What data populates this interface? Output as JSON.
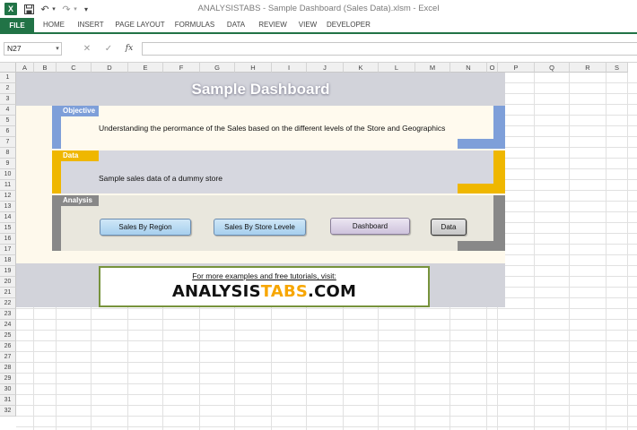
{
  "window": {
    "title": "ANALYSISTABS - Sample Dashboard (Sales Data).xlsm - Excel",
    "app_icon_letter": "X"
  },
  "quick_access": {
    "save_icon": "save-icon",
    "undo_icon": "undo-icon",
    "redo_icon": "redo-icon"
  },
  "ribbon": {
    "tabs": [
      {
        "label": "FILE",
        "active": true
      },
      {
        "label": "HOME"
      },
      {
        "label": "INSERT"
      },
      {
        "label": "PAGE LAYOUT"
      },
      {
        "label": "FORMULAS"
      },
      {
        "label": "DATA"
      },
      {
        "label": "REVIEW"
      },
      {
        "label": "VIEW"
      },
      {
        "label": "DEVELOPER"
      }
    ],
    "accent_color": "#217346"
  },
  "formula_bar": {
    "name_box": "N27",
    "cancel_glyph": "✕",
    "enter_glyph": "✓",
    "fx_label": "fx",
    "formula": ""
  },
  "sheet": {
    "columns": [
      "A",
      "B",
      "C",
      "D",
      "E",
      "F",
      "G",
      "H",
      "I",
      "J",
      "K",
      "L",
      "M",
      "N",
      "O",
      "P",
      "Q",
      "R",
      "S"
    ],
    "rows": [
      "1",
      "2",
      "3",
      "4",
      "5",
      "6",
      "7",
      "8",
      "9",
      "10",
      "11",
      "12",
      "13",
      "14",
      "15",
      "16",
      "17",
      "18",
      "19",
      "20",
      "21",
      "22",
      "23",
      "24",
      "25",
      "26",
      "27",
      "28",
      "29",
      "30",
      "31",
      "32"
    ]
  },
  "dashboard": {
    "title": "Sample Dashboard",
    "objective": {
      "label": "Objective",
      "text": "Understanding the perormance of the Sales based on the different levels of the Store and Geographics",
      "color": "#7e9fd9"
    },
    "data": {
      "label": "Data",
      "text": "Sample sales data of a dummy store",
      "color": "#efb700"
    },
    "analysis": {
      "label": "Analysis",
      "color": "#888888",
      "buttons": [
        {
          "label": "Sales By Region"
        },
        {
          "label": "Sales By Store Levele"
        },
        {
          "label": "Dashboard"
        },
        {
          "label": "Data"
        }
      ]
    },
    "promo": {
      "line1": "For more examples and free tutorials, visit:",
      "brand_prefix": "ANALYSIS",
      "brand_accent": "TABS",
      "brand_suffix": ".COM",
      "border_color": "#77933c",
      "accent_color": "#f7a600"
    }
  }
}
